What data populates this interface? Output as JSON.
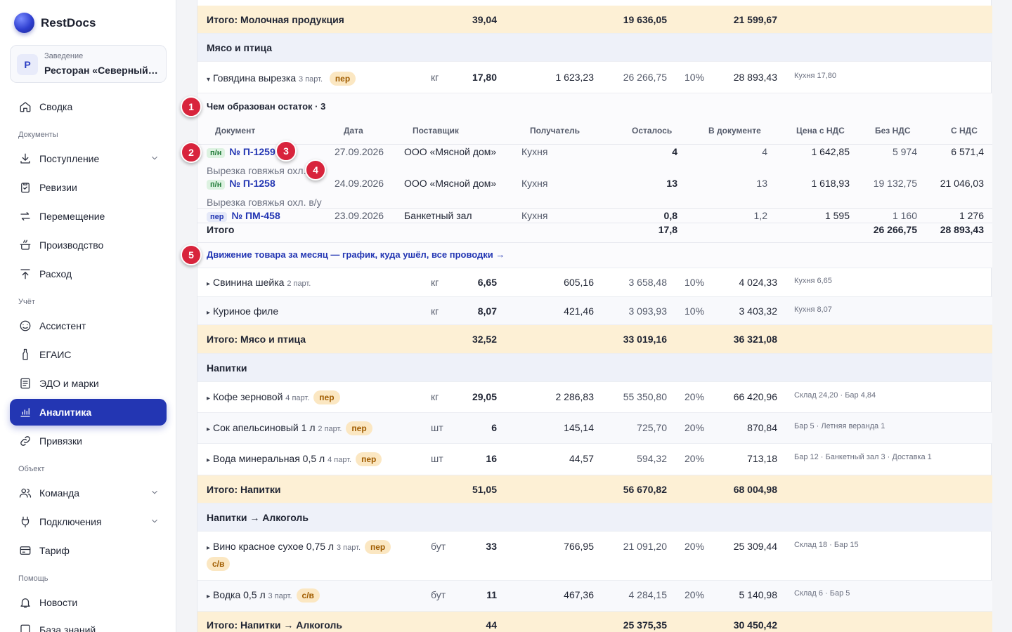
{
  "brand": {
    "name": "RestDocs"
  },
  "venue": {
    "avatar": "Р",
    "label": "Заведение",
    "name": "Ресторан «Северный ветер»"
  },
  "nav": {
    "summary": "Сводка",
    "section_docs": "Документы",
    "receipt": "Поступление",
    "audits": "Ревизии",
    "transfer": "Перемещение",
    "production": "Производство",
    "expense": "Расход",
    "section_accounting": "Учёт",
    "assistant": "Ассистент",
    "egais": "ЕГАИС",
    "edo": "ЭДО и марки",
    "analytics": "Аналитика",
    "bindings": "Привязки",
    "section_object": "Объект",
    "team": "Команда",
    "connections": "Подключения",
    "tariff": "Тариф",
    "section_help": "Помощь",
    "news": "Новости",
    "kb": "База знаний"
  },
  "table": {
    "total_dairy": {
      "label": "Итого: Молочная продукция",
      "qty": "39,04",
      "sum_no_vat": "19 636,05",
      "sum_vat": "21 599,67"
    },
    "group_meat": "Мясо и птица",
    "beef": {
      "name": "Говядина вырезка",
      "parts": "3 парт.",
      "pill": "пер",
      "unit": "кг",
      "qty": "17,80",
      "price": "1 623,23",
      "sum": "26 266,75",
      "vat": "10%",
      "total": "28 893,43",
      "where": "Кухня 17,80",
      "toggle": "▾"
    },
    "detail": {
      "title": "Чем образован остаток · 3",
      "headers": {
        "doc": "Документ",
        "date": "Дата",
        "supplier": "Поставщик",
        "recipient": "Получатель",
        "left": "Осталось",
        "in_doc": "В документе",
        "price_vat": "Цена с НДС",
        "no_vat": "Без НДС",
        "with_vat": "С НДС"
      },
      "rows": [
        {
          "tag": "п/н",
          "doc": "№ П-1259",
          "date": "27.09.2026",
          "supplier": "ООО «Мясной дом»",
          "recipient": "Кухня",
          "left": "4",
          "in_doc": "4",
          "price": "1 642,85",
          "no_vat": "5 974",
          "with_vat": "6 571,4",
          "note": "Вырезка говяжья охл. в/у"
        },
        {
          "tag": "п/н",
          "doc": "№ П-1258",
          "date": "24.09.2026",
          "supplier": "ООО «Мясной дом»",
          "recipient": "Кухня",
          "left": "13",
          "in_doc": "13",
          "price": "1 618,93",
          "no_vat": "19 132,75",
          "with_vat": "21 046,03",
          "note": "Вырезка говяжья охл. в/у"
        },
        {
          "tag": "пер",
          "doc": "№ ПМ-458",
          "date": "23.09.2026",
          "supplier": "Банкетный зал",
          "recipient": "Кухня",
          "left": "0,8",
          "in_doc": "1,2",
          "price": "1 595",
          "no_vat": "1 160",
          "with_vat": "1 276"
        }
      ],
      "total": {
        "label": "Итого",
        "left": "17,8",
        "no_vat": "26 266,75",
        "with_vat": "28 893,43"
      },
      "link": "Движение товара за месяц — график, куда ушёл, все проводки →"
    },
    "pork": {
      "toggle": "▸",
      "name": "Свинина шейка",
      "parts": "2 парт.",
      "unit": "кг",
      "qty": "6,65",
      "price": "605,16",
      "sum": "3 658,48",
      "vat": "10%",
      "total": "4 024,33",
      "where": "Кухня 6,65"
    },
    "chicken": {
      "toggle": "▸",
      "name": "Куриное филе",
      "parts": "",
      "unit": "кг",
      "qty": "8,07",
      "price": "421,46",
      "sum": "3 093,93",
      "vat": "10%",
      "total": "3 403,32",
      "where": "Кухня 8,07"
    },
    "total_meat": {
      "label": "Итого: Мясо и птица",
      "qty": "32,52",
      "sum_no_vat": "33 019,16",
      "sum_vat": "36 321,08"
    },
    "group_drinks": "Напитки",
    "coffee": {
      "toggle": "▸",
      "name": "Кофе зерновой",
      "parts": "4 парт.",
      "pill": "пер",
      "unit": "кг",
      "qty": "29,05",
      "price": "2 286,83",
      "sum": "55 350,80",
      "vat": "20%",
      "total": "66 420,96",
      "where": "Склад 24,20 · Бар 4,84"
    },
    "juice": {
      "toggle": "▸",
      "name": "Сок апельсиновый 1 л",
      "parts": "2 парт.",
      "pill": "пер",
      "unit": "шт",
      "qty": "6",
      "price": "145,14",
      "sum": "725,70",
      "vat": "20%",
      "total": "870,84",
      "where": "Бар 5 · Летняя веранда 1"
    },
    "water": {
      "toggle": "▸",
      "name": "Вода минеральная 0,5 л",
      "parts": "4 парт.",
      "pill": "пер",
      "unit": "шт",
      "qty": "16",
      "price": "44,57",
      "sum": "594,32",
      "vat": "20%",
      "total": "713,18",
      "where": "Бар 12 · Банкетный зал 3 · Доставка 1"
    },
    "total_drinks": {
      "label": "Итого: Напитки",
      "qty": "51,05",
      "sum_no_vat": "56 670,82",
      "sum_vat": "68 004,98"
    },
    "group_alcohol": "Напитки → Алкоголь",
    "wine": {
      "toggle": "▸",
      "name": "Вино красное сухое 0,75 л",
      "parts": "3 парт.",
      "pill": "пер",
      "pill2": "с/в",
      "unit": "бут",
      "qty": "33",
      "price": "766,95",
      "sum": "21 091,20",
      "vat": "20%",
      "total": "25 309,44",
      "where": "Склад 18 · Бар 15"
    },
    "vodka": {
      "toggle": "▸",
      "name": "Водка 0,5 л",
      "parts": "3 парт.",
      "pill": "с/в",
      "unit": "бут",
      "qty": "11",
      "price": "467,36",
      "sum": "4 284,15",
      "vat": "20%",
      "total": "5 140,98",
      "where": "Склад 6 · Бар 5"
    },
    "total_alcohol": {
      "label": "Итого: Напитки → Алкоголь",
      "qty": "44",
      "sum_no_vat": "25 375,35",
      "sum_vat": "30 450,42"
    }
  },
  "markers": [
    "1",
    "2",
    "3",
    "4",
    "5"
  ],
  "colors": {
    "accent": "#2336b3",
    "total_bg": "#fdf0d5",
    "group_bg": "#eef1f9",
    "marker": "#d8243c"
  }
}
